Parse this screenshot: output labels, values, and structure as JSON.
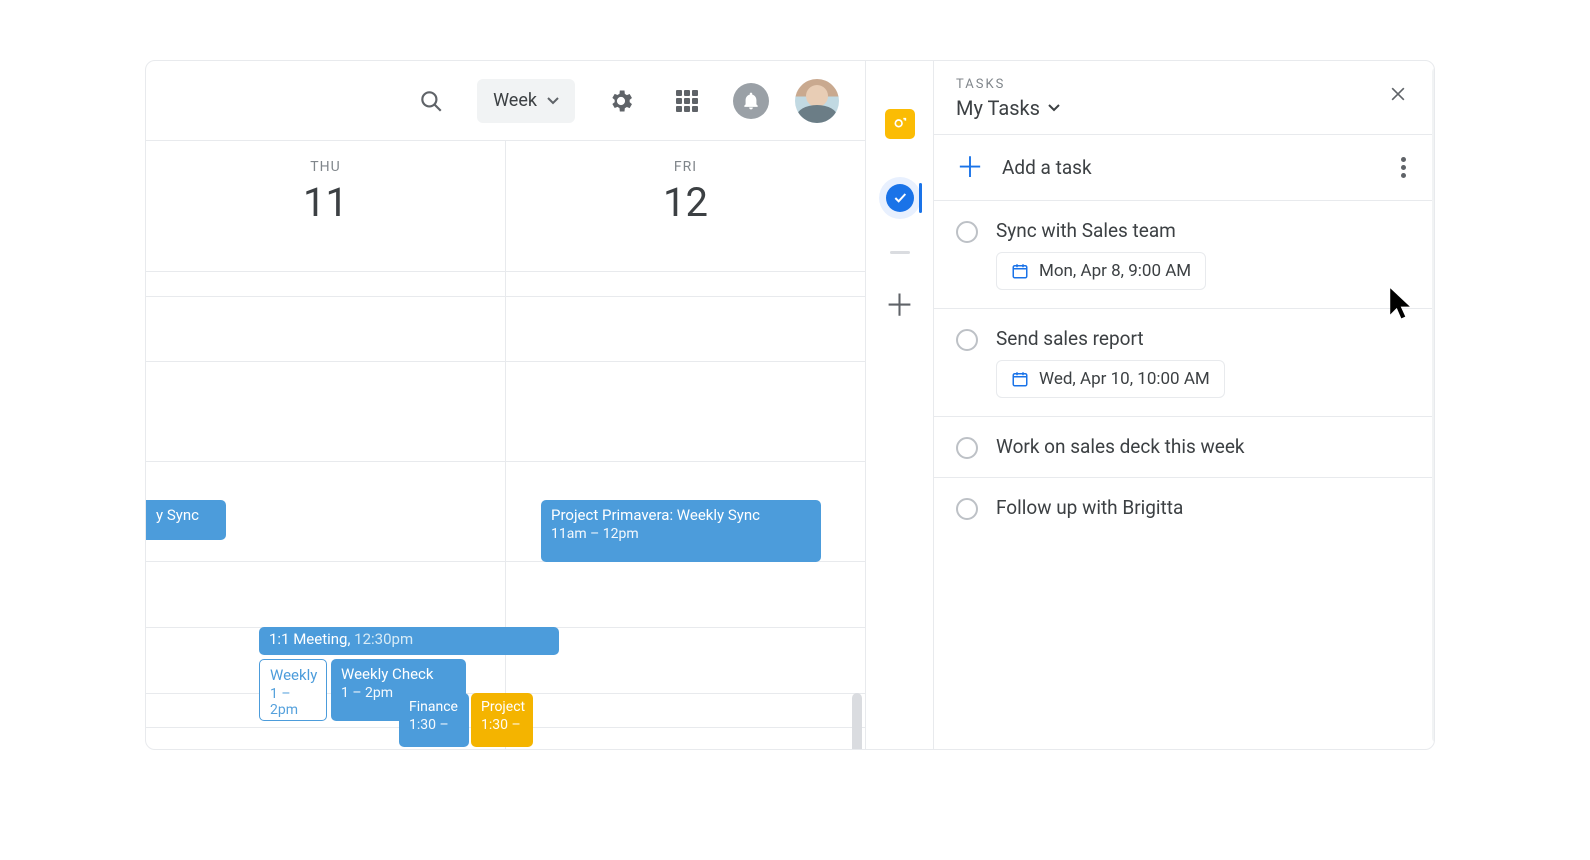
{
  "header": {
    "view_label": "Week"
  },
  "calendar": {
    "days": [
      {
        "dow": "THU",
        "num": "11"
      },
      {
        "dow": "FRI",
        "num": "12"
      }
    ],
    "events": {
      "sync_partial": {
        "title": "y Sync"
      },
      "meeting": {
        "title": "1:1 Meeting",
        "time": "12:30pm"
      },
      "weekly_a": {
        "title": "Weekly",
        "time": "1 – 2pm"
      },
      "weekly_b": {
        "title": "Weekly Check",
        "time": "1 – 2pm"
      },
      "finance": {
        "title": "Finance",
        "time": "1:30 –"
      },
      "project_frag": {
        "title": "Project",
        "time": "1:30 –"
      },
      "primavera": {
        "title": "Project Primavera: Weekly Sync",
        "time": "11am – 12pm"
      }
    }
  },
  "tasks_panel": {
    "eyebrow": "TASKS",
    "list_name": "My Tasks",
    "add_label": "Add a task",
    "items": [
      {
        "title": "Sync with Sales team",
        "date": "Mon, Apr 8, 9:00 AM"
      },
      {
        "title": "Send sales report",
        "date": "Wed, Apr 10, 10:00 AM"
      },
      {
        "title": "Work on sales deck this week"
      },
      {
        "title": "Follow up with Brigitta"
      }
    ]
  }
}
